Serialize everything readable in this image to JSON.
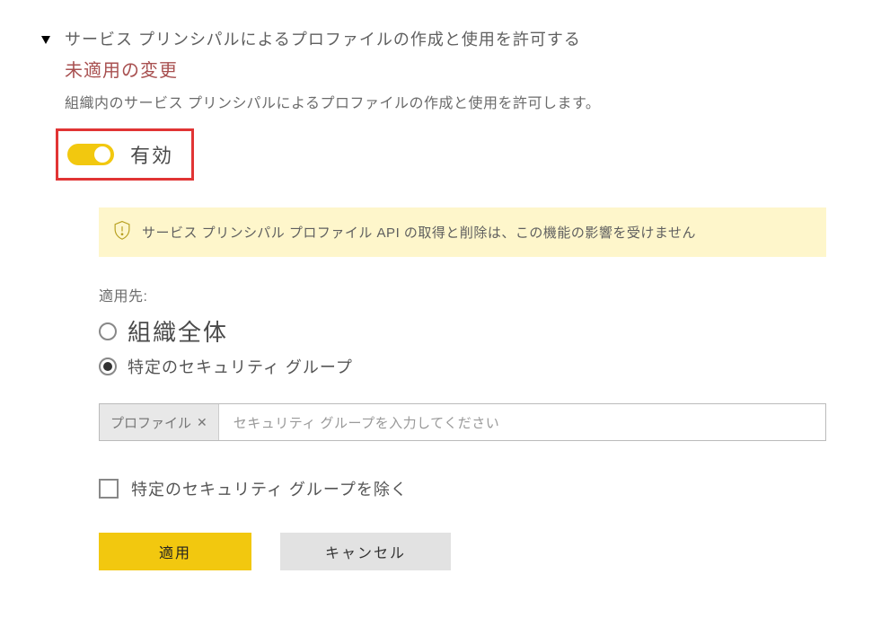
{
  "setting": {
    "title": "サービス プリンシパルによるプロファイルの作成と使用を許可する",
    "unapplied": "未適用の変更",
    "description": "組織内のサービス プリンシパルによるプロファイルの作成と使用を許可します。",
    "toggle_label": "有効"
  },
  "banner": {
    "text": "サービス プリンシパル プロファイル API の取得と削除は、この機能の影響を受けません"
  },
  "apply": {
    "label": "適用先:",
    "options": {
      "org": "組織全体",
      "specific": "特定のセキュリティ グループ"
    }
  },
  "tag_input": {
    "tag": "プロファイル",
    "placeholder": "セキュリティ グループを入力してください"
  },
  "exclude": {
    "label": "特定のセキュリティ グループを除く"
  },
  "buttons": {
    "apply": "適用",
    "cancel": "キャンセル"
  }
}
